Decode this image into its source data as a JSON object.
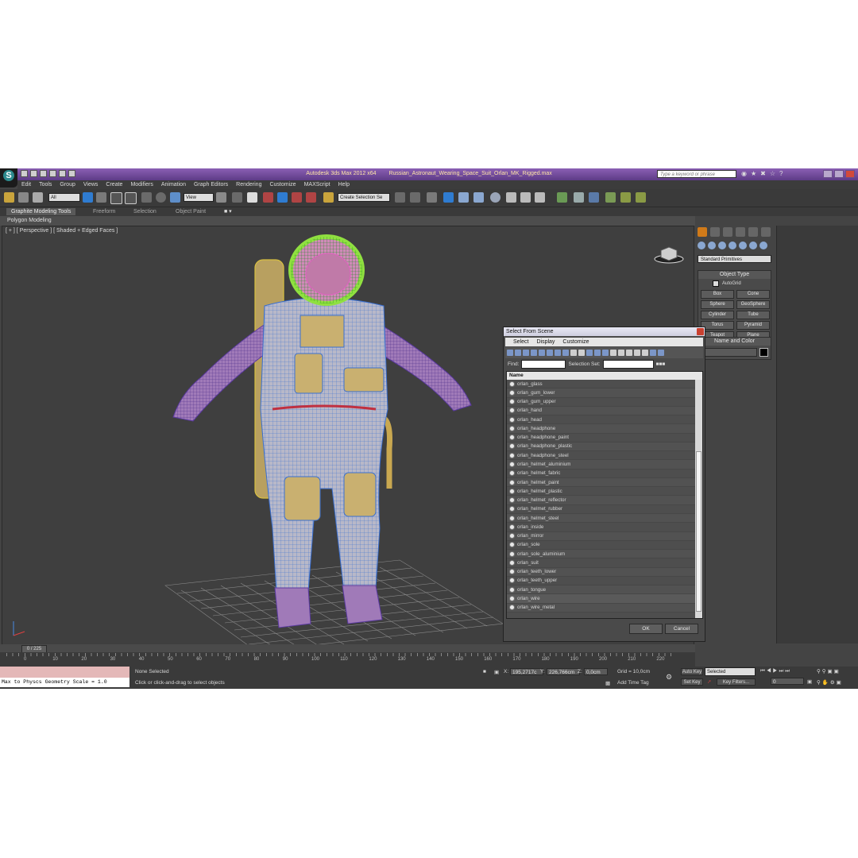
{
  "window": {
    "app_name": "Autodesk 3ds Max  2012 x64",
    "file_name": "Russian_Astronaut_Wearing_Space_Suit_Orlan_MK_Rigged.max",
    "help_search_placeholder": "Type a keyword or phrase"
  },
  "menu": [
    "Edit",
    "Tools",
    "Group",
    "Views",
    "Create",
    "Modifiers",
    "Animation",
    "Graph Editors",
    "Rendering",
    "Customize",
    "MAXScript",
    "Help"
  ],
  "toolbar": {
    "filter_value": "All",
    "reference_coord": "View",
    "named_selection_placeholder": "Create Selection Se"
  },
  "ribbon": {
    "tabs": [
      "Graphite Modeling Tools",
      "Freeform",
      "Selection",
      "Object Paint"
    ],
    "panel_label": "Polygon Modeling"
  },
  "viewport": {
    "label": "[ + ] [ Perspective ] [ Shaded + Edged Faces ]"
  },
  "command_panel": {
    "category_dropdown": "Standard Primitives",
    "object_type_header": "Object Type",
    "autogrid_label": "AutoGrid",
    "primitives": [
      "Box",
      "Cone",
      "Sphere",
      "GeoSphere",
      "Cylinder",
      "Tube",
      "Torus",
      "Pyramid",
      "Teapot",
      "Plane"
    ],
    "name_and_color_header": "Name and Color"
  },
  "dialog": {
    "title": "Select From Scene",
    "menu": [
      "Select",
      "Display",
      "Customize"
    ],
    "find_label": "Find:",
    "selection_set_label": "Selection Set:",
    "column_header": "Name",
    "items": [
      "orlan_glass",
      "orlan_gum_lower",
      "orlan_gum_upper",
      "orlan_hand",
      "orlan_head",
      "orlan_headphone",
      "orlan_headphone_paint",
      "orlan_headphone_plastic",
      "orlan_headphone_steel",
      "orlan_helmet_aluminium",
      "orlan_helmet_fabric",
      "orlan_helmet_paint",
      "orlan_helmet_plastic",
      "orlan_helmet_reflector",
      "orlan_helmet_rubber",
      "orlan_helmet_steel",
      "orlan_inside",
      "orlan_mirror",
      "orlan_sole",
      "orlan_sole_aluminium",
      "orlan_suit",
      "orlan_teeth_lower",
      "orlan_teeth_upper",
      "orlan_tongue",
      "orlan_wire",
      "orlan_wire_metal"
    ],
    "ok_label": "OK",
    "cancel_label": "Cancel"
  },
  "timeline": {
    "frame_counter": "0 / 225",
    "ruler_ticks": [
      "0",
      "10",
      "20",
      "30",
      "40",
      "50",
      "60",
      "70",
      "80",
      "90",
      "100",
      "110",
      "120",
      "130",
      "140",
      "150",
      "160",
      "170",
      "180",
      "190",
      "200",
      "210",
      "220"
    ]
  },
  "status": {
    "maxscript_output": "Max to Physcs Geometry Scale = 1.0",
    "selection_status": "None Selected",
    "prompt": "Click or click-and-drag to select objects",
    "x_label": "X:",
    "x_value": "195,2717c",
    "y_label": "Y:",
    "y_value": "226,766cm",
    "z_label": "Z:",
    "z_value": "0,0cm",
    "grid": "Grid = 10,0cm",
    "add_time_tag": "Add Time Tag",
    "auto_key": "Auto Key",
    "auto_key_dropdown": "Selected",
    "set_key": "Set Key",
    "key_filters": "Key Filters...",
    "frame_field": "0"
  }
}
